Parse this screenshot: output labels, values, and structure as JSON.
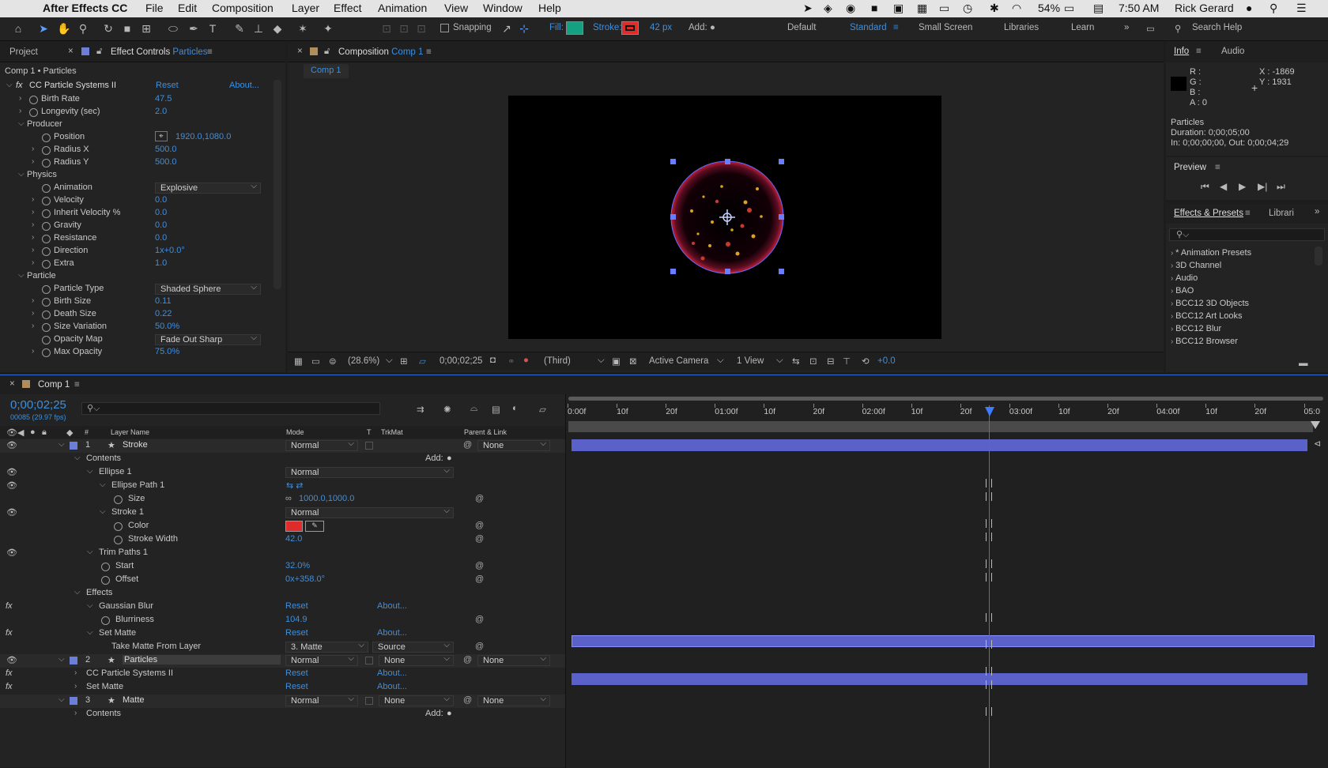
{
  "menubar": {
    "app_name": "After Effects CC",
    "menus": [
      "File",
      "Edit",
      "Composition",
      "Layer",
      "Effect",
      "Animation",
      "View",
      "Window",
      "Help"
    ],
    "battery": "54%",
    "time": "7:50 AM",
    "user": "Rick Gerard"
  },
  "toolbar": {
    "snapping": "Snapping",
    "fill": "Fill:",
    "fill_color": "#15a082",
    "stroke": "Stroke:",
    "stroke_color": "#e02b2b",
    "stroke_px": "42 px",
    "add": "Add:",
    "workspaces": [
      "Default",
      "Standard",
      "Small Screen",
      "Libraries",
      "Learn"
    ],
    "search_help": "Search Help"
  },
  "project_panel": {
    "tab_project": "Project",
    "tab_effect_controls": "Effect Controls",
    "tab_effect_layer": "Particles",
    "breadcrumb": "Comp 1 • Particles",
    "effect_name": "CC Particle Systems II",
    "reset": "Reset",
    "about": "About...",
    "rows": [
      {
        "label": "Birth Rate",
        "value": "47.5"
      },
      {
        "label": "Longevity (sec)",
        "value": "2.0"
      },
      {
        "label": "Producer",
        "value": ""
      },
      {
        "label": "Position",
        "value": "1920.0,1080.0"
      },
      {
        "label": "Radius X",
        "value": "500.0"
      },
      {
        "label": "Radius Y",
        "value": "500.0"
      },
      {
        "label": "Physics",
        "value": ""
      },
      {
        "label": "Animation",
        "value": "Explosive"
      },
      {
        "label": "Velocity",
        "value": "0.0"
      },
      {
        "label": "Inherit Velocity %",
        "value": "0.0"
      },
      {
        "label": "Gravity",
        "value": "0.0"
      },
      {
        "label": "Resistance",
        "value": "0.0"
      },
      {
        "label": "Direction",
        "value": "1x+0.0°"
      },
      {
        "label": "Extra",
        "value": "1.0"
      },
      {
        "label": "Particle",
        "value": ""
      },
      {
        "label": "Particle Type",
        "value": "Shaded Sphere"
      },
      {
        "label": "Birth Size",
        "value": "0.11"
      },
      {
        "label": "Death Size",
        "value": "0.22"
      },
      {
        "label": "Size Variation",
        "value": "50.0%"
      },
      {
        "label": "Opacity Map",
        "value": "Fade Out Sharp"
      },
      {
        "label": "Max Opacity",
        "value": "75.0%"
      }
    ]
  },
  "composition_panel": {
    "tab_label": "Composition",
    "tab_comp": "Comp 1",
    "comp_tab": "Comp 1",
    "zoom": "(28.6%)",
    "timecode": "0;00;02;25",
    "resolution": "(Third)",
    "camera": "Active Camera",
    "views": "1 View",
    "exposure": "+0.0"
  },
  "info_panel": {
    "tab_info": "Info",
    "tab_audio": "Audio",
    "r": "R :",
    "g": "G :",
    "b": "B :",
    "a": "A : 0",
    "x": "X : -1869",
    "y": "Y : 1931",
    "layer": "Particles",
    "duration": "Duration: 0;00;05;00",
    "in_out": "In: 0;00;00;00, Out: 0;00;04;29"
  },
  "preview_panel": {
    "title": "Preview"
  },
  "effects_panel": {
    "tab_effects": "Effects & Presets",
    "tab_libraries": "Librari",
    "items": [
      "* Animation Presets",
      "3D Channel",
      "Audio",
      "BAO",
      "BCC12 3D Objects",
      "BCC12 Art Looks",
      "BCC12 Blur",
      "BCC12 Browser"
    ]
  },
  "timeline": {
    "tab": "Comp 1",
    "timecode": "0;00;02;25",
    "frames": "00085 (29.97 fps)",
    "col_layer_name": "Layer Name",
    "col_mode": "Mode",
    "col_t": "T",
    "col_trkmat": "TrkMat",
    "col_parent": "Parent & Link",
    "ruler": [
      "0:00f",
      "10f",
      "20f",
      "01:00f",
      "10f",
      "20f",
      "02:00f",
      "10f",
      "20f",
      "03:00f",
      "10f",
      "20f",
      "04:00f",
      "10f",
      "20f",
      "05:0"
    ],
    "rows": [
      {
        "num": "1",
        "name": "Stroke",
        "mode": "Normal",
        "trkmat": "",
        "parent": "None",
        "value": ""
      },
      {
        "num": "",
        "name": "Contents",
        "mode": "",
        "trkmat": "",
        "parent": "",
        "value": "Add:"
      },
      {
        "num": "",
        "name": "Ellipse 1",
        "mode": "Normal",
        "trkmat": "",
        "parent": "",
        "value": ""
      },
      {
        "num": "",
        "name": "Ellipse Path 1",
        "mode": "",
        "trkmat": "",
        "parent": "",
        "value": ""
      },
      {
        "num": "",
        "name": "Size",
        "mode": "",
        "trkmat": "",
        "parent": "",
        "value": "1000.0,1000.0"
      },
      {
        "num": "",
        "name": "Stroke 1",
        "mode": "Normal",
        "trkmat": "",
        "parent": "",
        "value": ""
      },
      {
        "num": "",
        "name": "Color",
        "mode": "",
        "trkmat": "",
        "parent": "",
        "value": ""
      },
      {
        "num": "",
        "name": "Stroke Width",
        "mode": "",
        "trkmat": "",
        "parent": "",
        "value": "42.0"
      },
      {
        "num": "",
        "name": "Trim Paths 1",
        "mode": "",
        "trkmat": "",
        "parent": "",
        "value": ""
      },
      {
        "num": "",
        "name": "Start",
        "mode": "",
        "trkmat": "",
        "parent": "",
        "value": "32.0%"
      },
      {
        "num": "",
        "name": "Offset",
        "mode": "",
        "trkmat": "",
        "parent": "",
        "value": "0x+358.0°"
      },
      {
        "num": "",
        "name": "Effects",
        "mode": "",
        "trkmat": "",
        "parent": "",
        "value": ""
      },
      {
        "num": "",
        "name": "Gaussian Blur",
        "mode": "Reset",
        "trkmat": "About...",
        "parent": "",
        "value": ""
      },
      {
        "num": "",
        "name": "Blurriness",
        "mode": "",
        "trkmat": "",
        "parent": "",
        "value": "104.9"
      },
      {
        "num": "",
        "name": "Set Matte",
        "mode": "Reset",
        "trkmat": "About...",
        "parent": "",
        "value": ""
      },
      {
        "num": "",
        "name": "Take Matte From Layer",
        "mode": "3. Matte",
        "trkmat": "Source",
        "parent": "",
        "value": ""
      },
      {
        "num": "2",
        "name": "Particles",
        "mode": "Normal",
        "trkmat": "None",
        "parent": "None",
        "value": ""
      },
      {
        "num": "",
        "name": "CC Particle Systems II",
        "mode": "Reset",
        "trkmat": "About...",
        "parent": "",
        "value": ""
      },
      {
        "num": "",
        "name": "Set Matte",
        "mode": "Reset",
        "trkmat": "About...",
        "parent": "",
        "value": ""
      },
      {
        "num": "3",
        "name": "Matte",
        "mode": "Normal",
        "trkmat": "None",
        "parent": "None",
        "value": ""
      },
      {
        "num": "",
        "name": "Contents",
        "mode": "",
        "trkmat": "",
        "parent": "",
        "value": "Add:"
      }
    ]
  }
}
